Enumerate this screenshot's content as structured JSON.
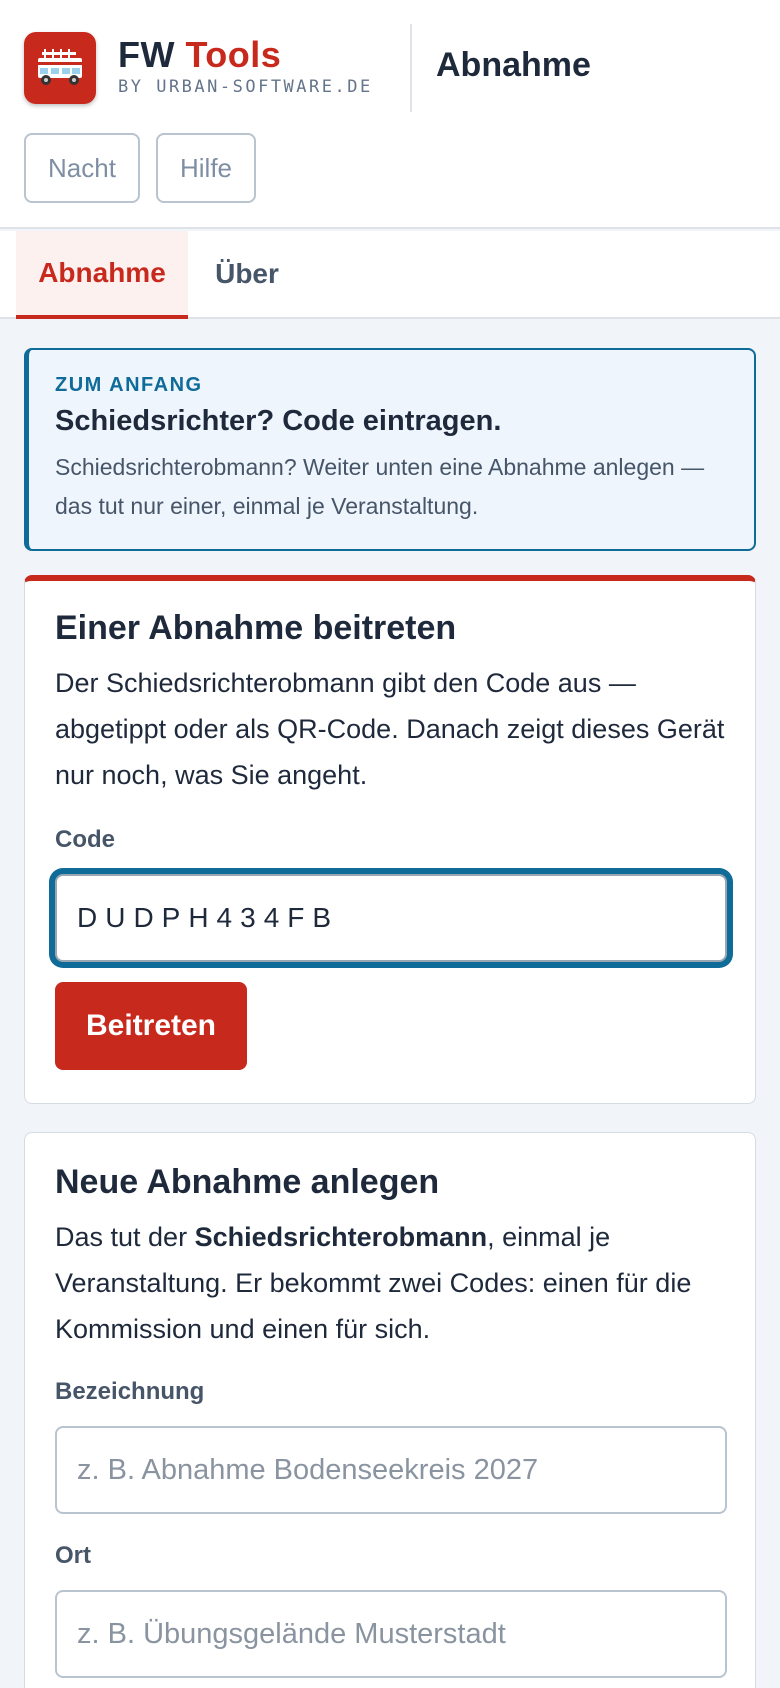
{
  "header": {
    "brand_part1": "FW",
    "brand_part2": "Tools",
    "brand_sub": "BY URBAN-SOFTWARE.DE",
    "page_title": "Abnahme",
    "night_button": "Nacht",
    "help_button": "Hilfe",
    "logo_icon": "fire-truck-icon"
  },
  "tabs": [
    {
      "label": "Abnahme",
      "active": true
    },
    {
      "label": "Über",
      "active": false
    }
  ],
  "info": {
    "kicker": "ZUM ANFANG",
    "title": "Schiedsrichter? Code eintragen.",
    "text": "Schiedsrichterobmann? Weiter unten eine Abnahme anlegen — das tut nur einer, einmal je Veranstaltung."
  },
  "join": {
    "title": "Einer Abnahme beitreten",
    "text": "Der Schiedsrichterobmann gibt den Code aus — abgetippt oder als QR-Code. Danach zeigt dieses Gerät nur noch, was Sie angeht.",
    "code_label": "Code",
    "code_value": "DUDPH434FB",
    "submit_label": "Beitreten"
  },
  "create": {
    "title": "Neue Abnahme anlegen",
    "text_before": "Das tut der ",
    "text_bold": "Schiedsrichterobmann",
    "text_after": ", einmal je Veranstaltung. Er bekommt zwei Codes: einen für die Kommission und einen für sich.",
    "name_label": "Bezeichnung",
    "name_placeholder": "z. B. Abnahme Bodenseekreis 2027",
    "place_label": "Ort",
    "place_placeholder": "z. B. Übungsgelände Musterstadt"
  },
  "colors": {
    "brand_red": "#c8291d",
    "info_blue": "#0f6b97",
    "background": "#f1f5f9"
  }
}
